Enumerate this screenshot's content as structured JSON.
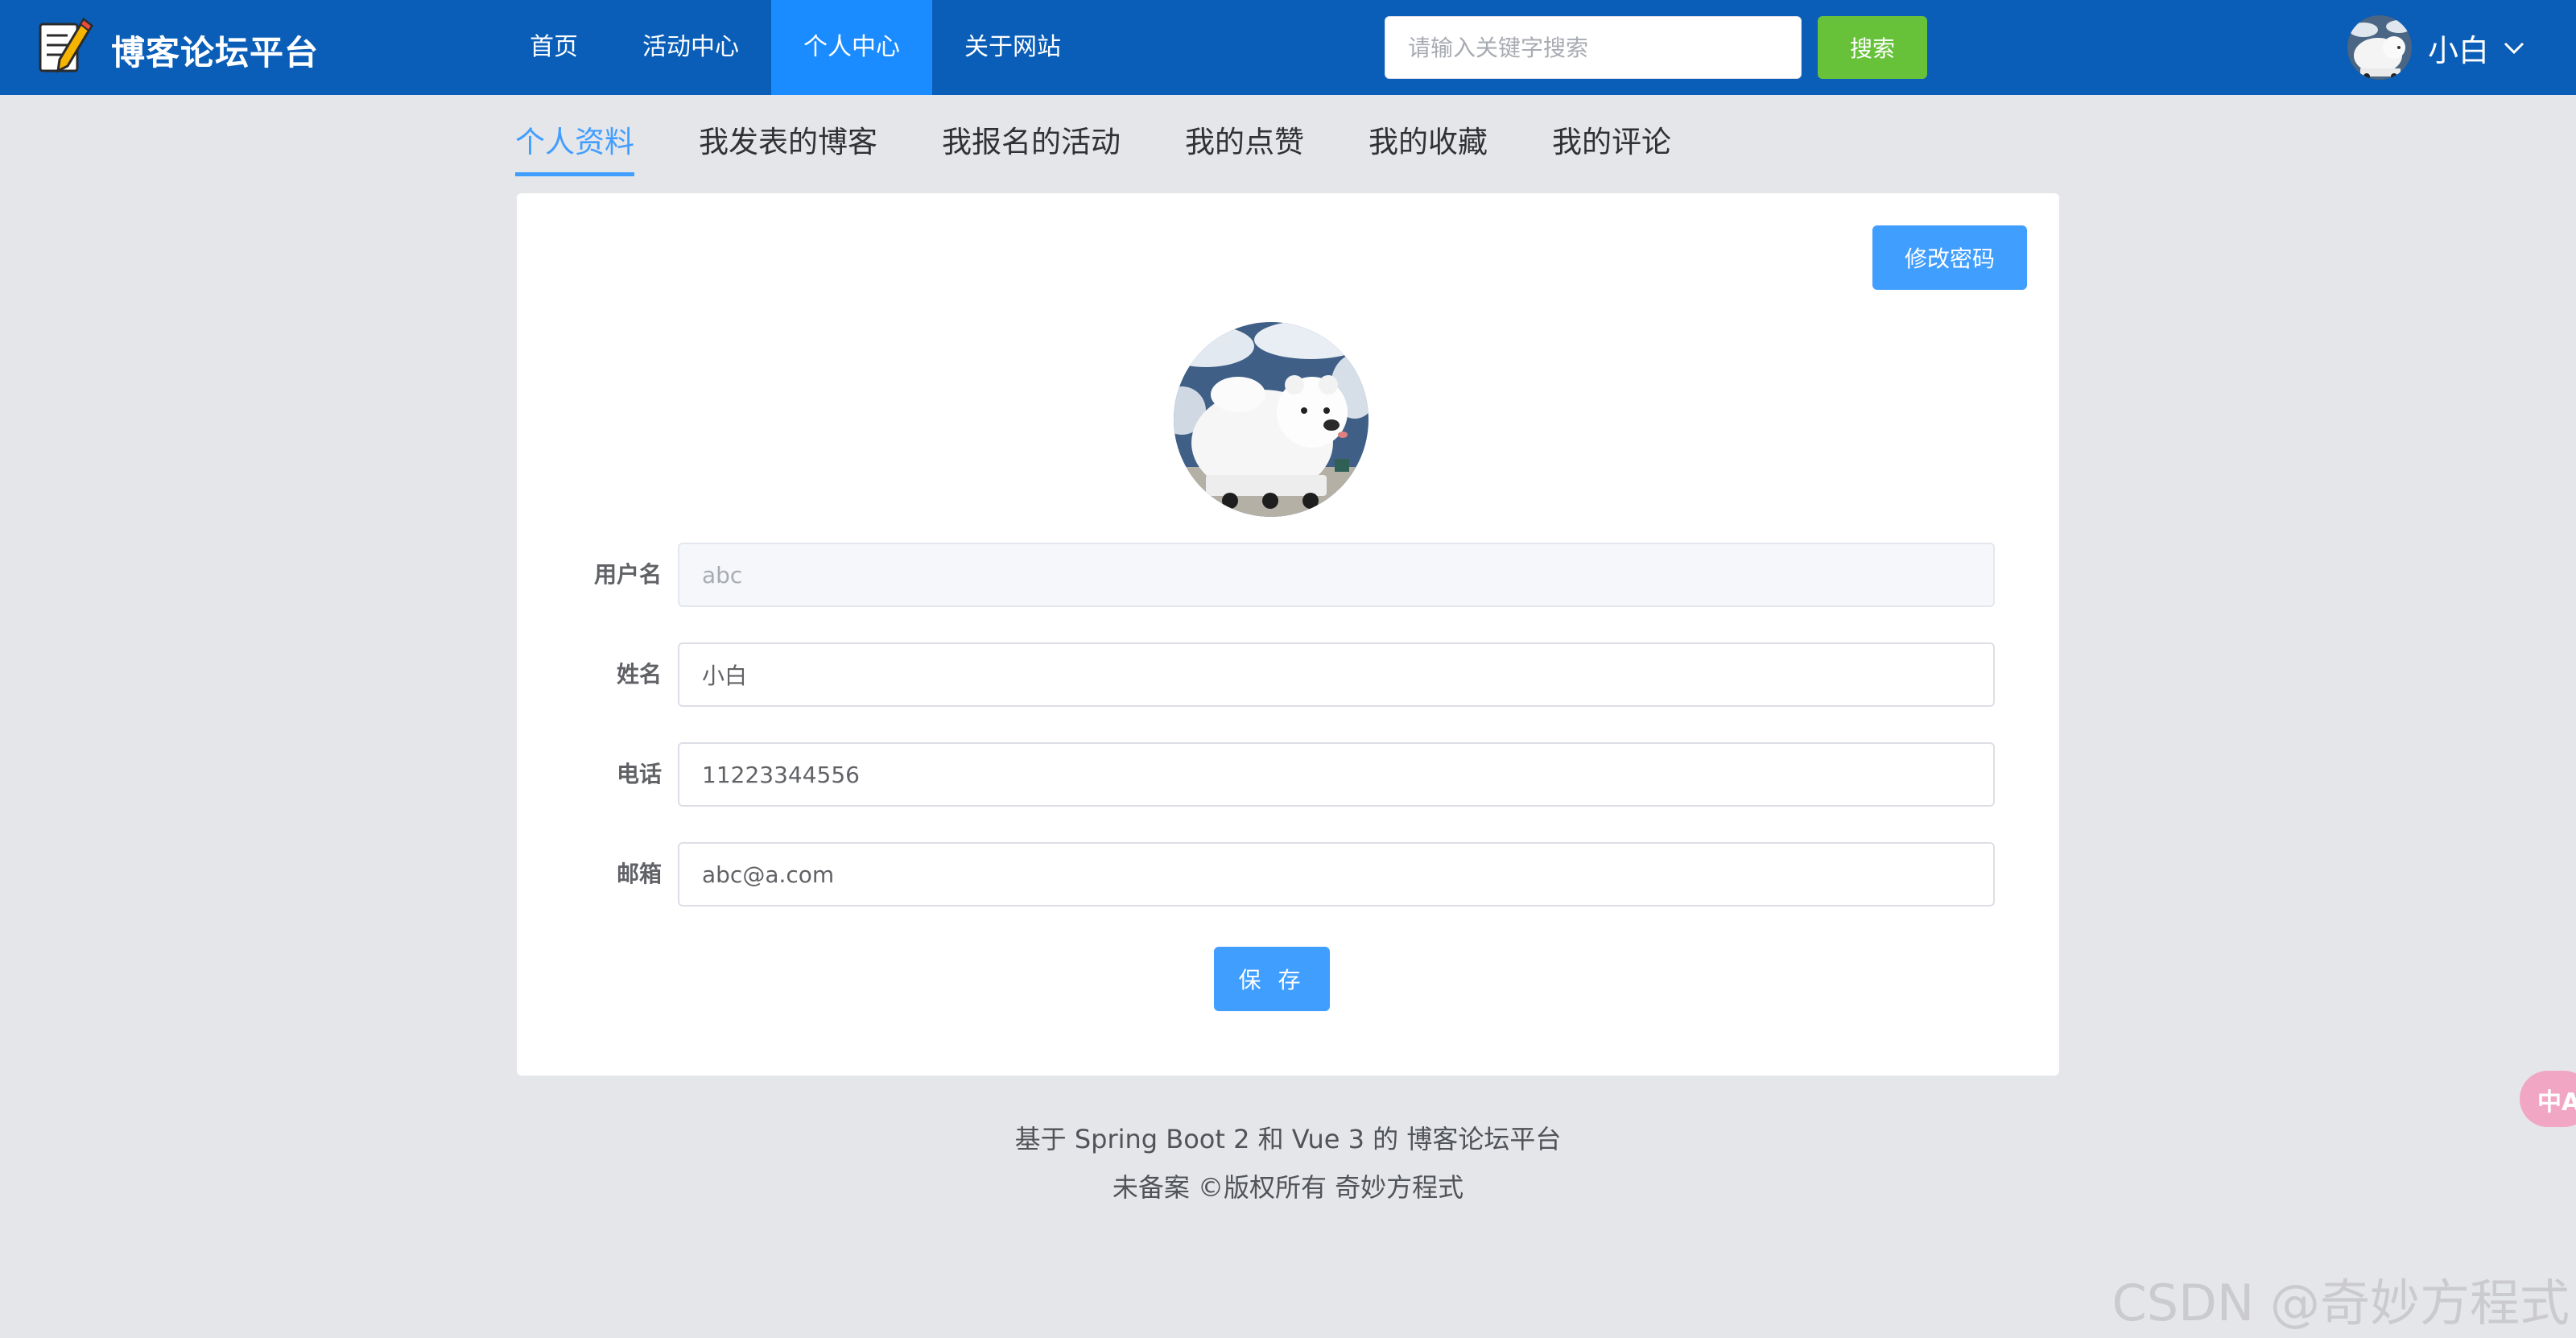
{
  "header": {
    "brand": "博客论坛平台",
    "nav": [
      "首页",
      "活动中心",
      "个人中心",
      "关于网站"
    ],
    "active_nav": 2,
    "search": {
      "placeholder": "请输入关键字搜索",
      "button": "搜索"
    },
    "user": {
      "name": "小白"
    }
  },
  "tabs": {
    "items": [
      "个人资料",
      "我发表的博客",
      "我报名的活动",
      "我的点赞",
      "我的收藏",
      "我的评论"
    ],
    "active": 0
  },
  "profile": {
    "change_password_label": "修改密码",
    "fields": [
      {
        "label": "用户名",
        "value": "abc",
        "disabled": true
      },
      {
        "label": "姓名",
        "value": "小白",
        "disabled": false
      },
      {
        "label": "电话",
        "value": "11223344556",
        "disabled": false
      },
      {
        "label": "邮箱",
        "value": "abc@a.com",
        "disabled": false
      }
    ],
    "save_label": "保 存"
  },
  "footer": {
    "line1": "基于 Spring Boot 2 和 Vue 3 的 博客论坛平台",
    "line2": "未备案 ©版权所有 奇妙方程式"
  },
  "floating": {
    "translate_label": "中A"
  },
  "watermark": "CSDN @奇妙方程式",
  "colors": {
    "header_bg": "#0a5eb8",
    "nav_active": "#1a8cff",
    "primary": "#409eff",
    "success": "#67c23a",
    "page_bg": "#e5e6ea"
  }
}
